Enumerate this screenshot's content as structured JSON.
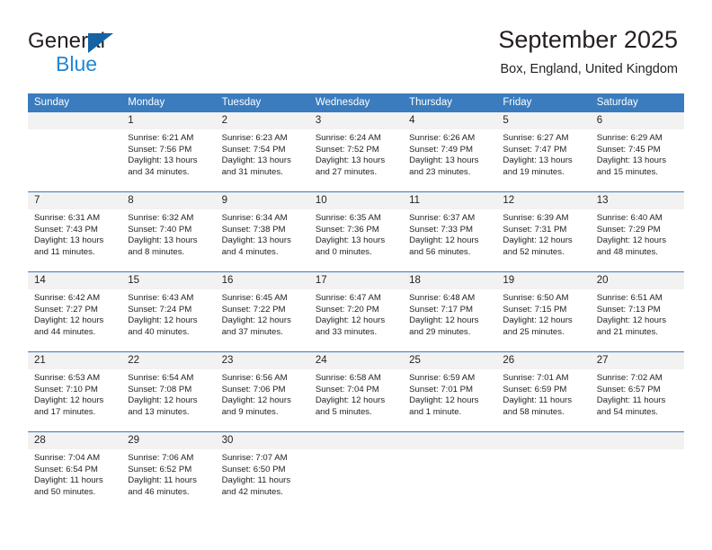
{
  "brand": {
    "name_top": "General",
    "name_bottom": "Blue",
    "accent_color": "#1463a5",
    "accent_color_light": "#2287d4"
  },
  "header": {
    "title": "September 2025",
    "subtitle": "Box, England, United Kingdom"
  },
  "theme": {
    "header_row_bg": "#3a7cbe",
    "day_number_bg": "#f2f2f2",
    "text_color": "#231f20"
  },
  "calendar": {
    "weekday_headers": [
      "Sunday",
      "Monday",
      "Tuesday",
      "Wednesday",
      "Thursday",
      "Friday",
      "Saturday"
    ],
    "weeks": [
      [
        {
          "day": "",
          "empty": true,
          "sunrise": "",
          "sunset": "",
          "daylight_line1": "",
          "daylight_line2": ""
        },
        {
          "day": "1",
          "sunrise": "Sunrise: 6:21 AM",
          "sunset": "Sunset: 7:56 PM",
          "daylight_line1": "Daylight: 13 hours",
          "daylight_line2": "and 34 minutes."
        },
        {
          "day": "2",
          "sunrise": "Sunrise: 6:23 AM",
          "sunset": "Sunset: 7:54 PM",
          "daylight_line1": "Daylight: 13 hours",
          "daylight_line2": "and 31 minutes."
        },
        {
          "day": "3",
          "sunrise": "Sunrise: 6:24 AM",
          "sunset": "Sunset: 7:52 PM",
          "daylight_line1": "Daylight: 13 hours",
          "daylight_line2": "and 27 minutes."
        },
        {
          "day": "4",
          "sunrise": "Sunrise: 6:26 AM",
          "sunset": "Sunset: 7:49 PM",
          "daylight_line1": "Daylight: 13 hours",
          "daylight_line2": "and 23 minutes."
        },
        {
          "day": "5",
          "sunrise": "Sunrise: 6:27 AM",
          "sunset": "Sunset: 7:47 PM",
          "daylight_line1": "Daylight: 13 hours",
          "daylight_line2": "and 19 minutes."
        },
        {
          "day": "6",
          "sunrise": "Sunrise: 6:29 AM",
          "sunset": "Sunset: 7:45 PM",
          "daylight_line1": "Daylight: 13 hours",
          "daylight_line2": "and 15 minutes."
        }
      ],
      [
        {
          "day": "7",
          "sunrise": "Sunrise: 6:31 AM",
          "sunset": "Sunset: 7:43 PM",
          "daylight_line1": "Daylight: 13 hours",
          "daylight_line2": "and 11 minutes."
        },
        {
          "day": "8",
          "sunrise": "Sunrise: 6:32 AM",
          "sunset": "Sunset: 7:40 PM",
          "daylight_line1": "Daylight: 13 hours",
          "daylight_line2": "and 8 minutes."
        },
        {
          "day": "9",
          "sunrise": "Sunrise: 6:34 AM",
          "sunset": "Sunset: 7:38 PM",
          "daylight_line1": "Daylight: 13 hours",
          "daylight_line2": "and 4 minutes."
        },
        {
          "day": "10",
          "sunrise": "Sunrise: 6:35 AM",
          "sunset": "Sunset: 7:36 PM",
          "daylight_line1": "Daylight: 13 hours",
          "daylight_line2": "and 0 minutes."
        },
        {
          "day": "11",
          "sunrise": "Sunrise: 6:37 AM",
          "sunset": "Sunset: 7:33 PM",
          "daylight_line1": "Daylight: 12 hours",
          "daylight_line2": "and 56 minutes."
        },
        {
          "day": "12",
          "sunrise": "Sunrise: 6:39 AM",
          "sunset": "Sunset: 7:31 PM",
          "daylight_line1": "Daylight: 12 hours",
          "daylight_line2": "and 52 minutes."
        },
        {
          "day": "13",
          "sunrise": "Sunrise: 6:40 AM",
          "sunset": "Sunset: 7:29 PM",
          "daylight_line1": "Daylight: 12 hours",
          "daylight_line2": "and 48 minutes."
        }
      ],
      [
        {
          "day": "14",
          "sunrise": "Sunrise: 6:42 AM",
          "sunset": "Sunset: 7:27 PM",
          "daylight_line1": "Daylight: 12 hours",
          "daylight_line2": "and 44 minutes."
        },
        {
          "day": "15",
          "sunrise": "Sunrise: 6:43 AM",
          "sunset": "Sunset: 7:24 PM",
          "daylight_line1": "Daylight: 12 hours",
          "daylight_line2": "and 40 minutes."
        },
        {
          "day": "16",
          "sunrise": "Sunrise: 6:45 AM",
          "sunset": "Sunset: 7:22 PM",
          "daylight_line1": "Daylight: 12 hours",
          "daylight_line2": "and 37 minutes."
        },
        {
          "day": "17",
          "sunrise": "Sunrise: 6:47 AM",
          "sunset": "Sunset: 7:20 PM",
          "daylight_line1": "Daylight: 12 hours",
          "daylight_line2": "and 33 minutes."
        },
        {
          "day": "18",
          "sunrise": "Sunrise: 6:48 AM",
          "sunset": "Sunset: 7:17 PM",
          "daylight_line1": "Daylight: 12 hours",
          "daylight_line2": "and 29 minutes."
        },
        {
          "day": "19",
          "sunrise": "Sunrise: 6:50 AM",
          "sunset": "Sunset: 7:15 PM",
          "daylight_line1": "Daylight: 12 hours",
          "daylight_line2": "and 25 minutes."
        },
        {
          "day": "20",
          "sunrise": "Sunrise: 6:51 AM",
          "sunset": "Sunset: 7:13 PM",
          "daylight_line1": "Daylight: 12 hours",
          "daylight_line2": "and 21 minutes."
        }
      ],
      [
        {
          "day": "21",
          "sunrise": "Sunrise: 6:53 AM",
          "sunset": "Sunset: 7:10 PM",
          "daylight_line1": "Daylight: 12 hours",
          "daylight_line2": "and 17 minutes."
        },
        {
          "day": "22",
          "sunrise": "Sunrise: 6:54 AM",
          "sunset": "Sunset: 7:08 PM",
          "daylight_line1": "Daylight: 12 hours",
          "daylight_line2": "and 13 minutes."
        },
        {
          "day": "23",
          "sunrise": "Sunrise: 6:56 AM",
          "sunset": "Sunset: 7:06 PM",
          "daylight_line1": "Daylight: 12 hours",
          "daylight_line2": "and 9 minutes."
        },
        {
          "day": "24",
          "sunrise": "Sunrise: 6:58 AM",
          "sunset": "Sunset: 7:04 PM",
          "daylight_line1": "Daylight: 12 hours",
          "daylight_line2": "and 5 minutes."
        },
        {
          "day": "25",
          "sunrise": "Sunrise: 6:59 AM",
          "sunset": "Sunset: 7:01 PM",
          "daylight_line1": "Daylight: 12 hours",
          "daylight_line2": "and 1 minute."
        },
        {
          "day": "26",
          "sunrise": "Sunrise: 7:01 AM",
          "sunset": "Sunset: 6:59 PM",
          "daylight_line1": "Daylight: 11 hours",
          "daylight_line2": "and 58 minutes."
        },
        {
          "day": "27",
          "sunrise": "Sunrise: 7:02 AM",
          "sunset": "Sunset: 6:57 PM",
          "daylight_line1": "Daylight: 11 hours",
          "daylight_line2": "and 54 minutes."
        }
      ],
      [
        {
          "day": "28",
          "sunrise": "Sunrise: 7:04 AM",
          "sunset": "Sunset: 6:54 PM",
          "daylight_line1": "Daylight: 11 hours",
          "daylight_line2": "and 50 minutes."
        },
        {
          "day": "29",
          "sunrise": "Sunrise: 7:06 AM",
          "sunset": "Sunset: 6:52 PM",
          "daylight_line1": "Daylight: 11 hours",
          "daylight_line2": "and 46 minutes."
        },
        {
          "day": "30",
          "sunrise": "Sunrise: 7:07 AM",
          "sunset": "Sunset: 6:50 PM",
          "daylight_line1": "Daylight: 11 hours",
          "daylight_line2": "and 42 minutes."
        },
        {
          "day": "",
          "empty": true,
          "sunrise": "",
          "sunset": "",
          "daylight_line1": "",
          "daylight_line2": ""
        },
        {
          "day": "",
          "empty": true,
          "sunrise": "",
          "sunset": "",
          "daylight_line1": "",
          "daylight_line2": ""
        },
        {
          "day": "",
          "empty": true,
          "sunrise": "",
          "sunset": "",
          "daylight_line1": "",
          "daylight_line2": ""
        },
        {
          "day": "",
          "empty": true,
          "sunrise": "",
          "sunset": "",
          "daylight_line1": "",
          "daylight_line2": ""
        }
      ]
    ]
  }
}
